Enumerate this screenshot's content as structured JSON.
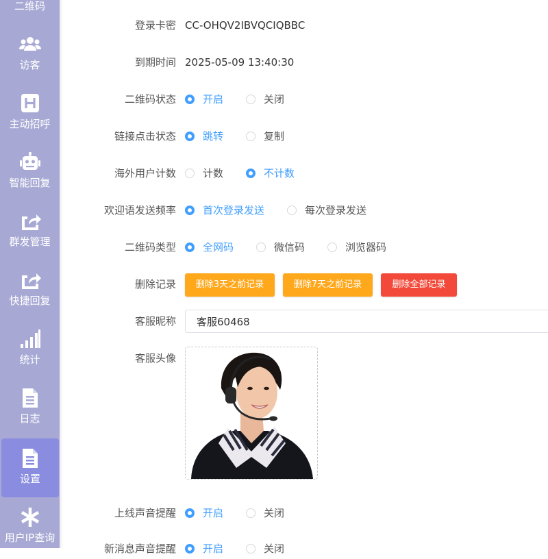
{
  "sidebar": {
    "top_partial_label": "二维码",
    "items": [
      {
        "label": "访客",
        "icon": "users-icon"
      },
      {
        "label": "主动招呼",
        "icon": "h-square-icon"
      },
      {
        "label": "智能回复",
        "icon": "robot-icon"
      },
      {
        "label": "群发管理",
        "icon": "share-square-icon"
      },
      {
        "label": "快捷回复",
        "icon": "share-square-icon"
      },
      {
        "label": "统计",
        "icon": "signal-bars-icon"
      },
      {
        "label": "日志",
        "icon": "document-icon"
      },
      {
        "label": "设置",
        "icon": "document-icon",
        "active": true
      },
      {
        "label": "用户IP查询",
        "icon": "asterisk-icon"
      }
    ]
  },
  "form": {
    "card_key": {
      "label": "登录卡密",
      "value": "CC-OHQV2IBVQCIQBBC"
    },
    "expire_time": {
      "label": "到期时间",
      "value": "2025-05-09 13:40:30"
    },
    "qrcode_status": {
      "label": "二维码状态",
      "options": [
        "开启",
        "关闭"
      ],
      "selected": "开启"
    },
    "link_click": {
      "label": "链接点击状态",
      "options": [
        "跳转",
        "复制"
      ],
      "selected": "跳转"
    },
    "overseas_count": {
      "label": "海外用户计数",
      "options": [
        "计数",
        "不计数"
      ],
      "selected": "不计数"
    },
    "welcome_freq": {
      "label": "欢迎语发送频率",
      "options": [
        "首次登录发送",
        "每次登录发送"
      ],
      "selected": "首次登录发送"
    },
    "qrcode_type": {
      "label": "二维码类型",
      "options": [
        "全网码",
        "微信码",
        "浏览器码"
      ],
      "selected": "全网码"
    },
    "delete_records": {
      "label": "删除记录",
      "buttons": [
        "删除3天之前记录",
        "删除7天之前记录",
        "删除全部记录"
      ]
    },
    "nickname": {
      "label": "客服昵称",
      "value": "客服60468"
    },
    "avatar": {
      "label": "客服头像"
    },
    "online_sound": {
      "label": "上线声音提醒",
      "options": [
        "开启",
        "关闭"
      ],
      "selected": "开启"
    },
    "message_sound": {
      "label": "新消息声音提醒",
      "options": [
        "开启",
        "关闭"
      ],
      "selected": "开启"
    }
  },
  "colors": {
    "sidebar_bg": "#a7a9d4",
    "sidebar_active": "#8a8ddf",
    "accent_blue": "#409eff",
    "button_orange": "#ffa81c",
    "button_red": "#f3493a"
  }
}
